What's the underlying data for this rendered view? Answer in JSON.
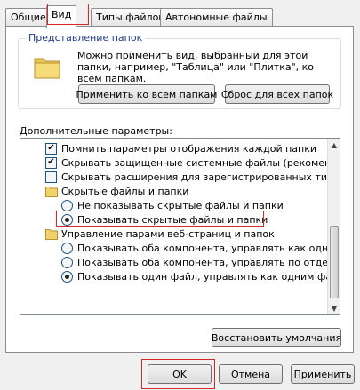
{
  "tabs": [
    {
      "label": "Общие"
    },
    {
      "label": "Вид"
    },
    {
      "label": "Типы файлов"
    },
    {
      "label": "Автономные файлы"
    }
  ],
  "folder_view": {
    "title": "Представление папок",
    "description": "Можно применить вид, выбранный для этой папки, например, \"Таблица\" или \"Плитка\", ко всем папкам.",
    "apply_all_label": "Применить ко всем папкам",
    "reset_all_label": "Сброс для всех папок"
  },
  "advanced": {
    "label": "Дополнительные параметры:",
    "items": [
      {
        "label": "Помнить параметры отображения каждой папки",
        "type": "checkbox",
        "checked": true
      },
      {
        "label": "Скрывать защищенные системные файлы (рекомендуется)",
        "type": "checkbox",
        "checked": true
      },
      {
        "label": "Скрывать расширения для зарегистрированных типов файлов",
        "type": "checkbox",
        "checked": false
      },
      {
        "label": "Скрытые файлы и папки",
        "type": "folder"
      },
      {
        "label": "Не показывать скрытые файлы и папки",
        "type": "radio",
        "checked": false
      },
      {
        "label": "Показывать скрытые файлы и папки",
        "type": "radio",
        "checked": true
      },
      {
        "label": "Управление парами веб-страниц и папок",
        "type": "folder"
      },
      {
        "label": "Показывать оба компонента, управлять как одним файлом",
        "type": "radio",
        "checked": false
      },
      {
        "label": "Показывать оба компонента, управлять по отдельности",
        "type": "radio",
        "checked": false
      },
      {
        "label": "Показывать один файл, управлять как одним файлом",
        "type": "radio",
        "checked": true
      }
    ]
  },
  "restore_defaults_label": "Восстановить умолчания",
  "dialog_buttons": {
    "ok": "OK",
    "cancel": "Отмена",
    "apply": "Применить"
  },
  "colors": {
    "highlight": "#d9262d",
    "group_title": "#1e3a8a"
  }
}
